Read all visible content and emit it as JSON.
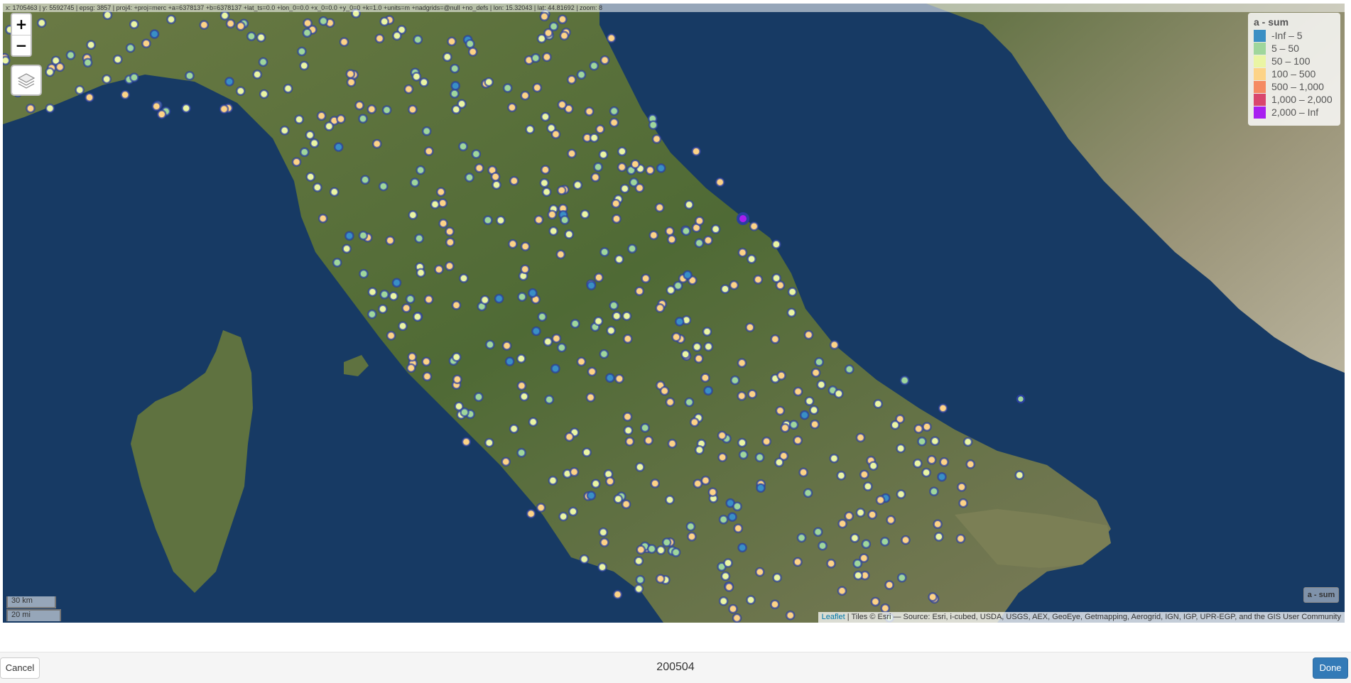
{
  "coords_readout": "x: 1705463 | y: 5592745 | epsg: 3857 | proj4: +proj=merc +a=6378137 +b=6378137 +lat_ts=0.0 +lon_0=0.0 +x_0=0.0 +y_0=0 +k=1.0 +units=m +nadgrids=@null +no_defs | lon: 15.32043 | lat: 44.81692 | zoom: 8",
  "zoom": {
    "in_label": "+",
    "out_label": "−"
  },
  "layers_icon": "layers-icon",
  "legend": {
    "title": "a - sum",
    "items": [
      {
        "label": "-Inf – 5",
        "color": "#3a8fc4"
      },
      {
        "label": "5 – 50",
        "color": "#9fd69c"
      },
      {
        "label": "50 – 100",
        "color": "#eaf5a4"
      },
      {
        "label": "100 – 500",
        "color": "#fdd387"
      },
      {
        "label": "500 – 1,000",
        "color": "#f58a62"
      },
      {
        "label": "1,000 – 2,000",
        "color": "#d9466d"
      },
      {
        "label": "2,000 – Inf",
        "color": "#a81ff0"
      }
    ]
  },
  "scale": {
    "km": "30 km",
    "mi": "20 mi"
  },
  "layer_tag": "a - sum",
  "attribution": {
    "link": "Leaflet",
    "text": " | Tiles © Esri — Source: Esri, i-cubed, USDA, USGS, AEX, GeoEye, Getmapping, Aerogrid, IGN, IGP, UPR-EGP, and the GIS User Community"
  },
  "bottom_bar": {
    "cancel_label": "Cancel",
    "title": "200504",
    "done_label": "Done"
  },
  "colors": {
    "sea": "#173a64",
    "land": "#5c6e3e",
    "marker_stroke": "#2a3fa0",
    "accent": "#337ab7"
  }
}
